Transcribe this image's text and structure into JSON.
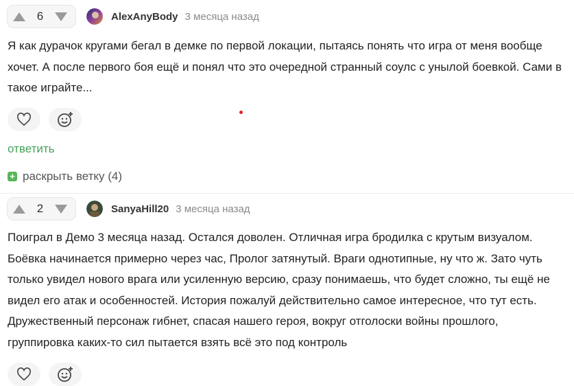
{
  "comments": [
    {
      "votes": "6",
      "username": "AlexAnyBody",
      "date": "3 месяца назад",
      "text": "Я как дурачок кругами бегал в демке по первой локации, пытаясь понять что игра от меня вообще хочет. А после первого боя ещё и понял что это очередной странный соулс с унылой боевкой. Сами в такое играйте...",
      "reply_label": "ответить",
      "expand_label": "раскрыть ветку (4)"
    },
    {
      "votes": "2",
      "username": "SanyaHill20",
      "date": "3 месяца назад",
      "text": "Поиграл в Демо 3 месяца назад. Остался доволен. Отличная игра бродилка с крутым визуалом. Боёвка начинается примерно через час, Пролог затянутый. Враги однотипные, ну что ж. Зато чуть только увидел нового врага или усиленную версию, сразу понимаешь, что будет сложно, ты ещё не видел его атак и особенностей. История пожалуй действительно самое интересное, что тут есть. Дружественный персонаж гибнет, спасая нашего героя, вокруг отголоски войны прошлого, группировка каких-то сил пытается взять всё это под контроль"
    }
  ],
  "colors": {
    "accent_green": "#44a35c",
    "vote_bg": "#f6f6f6",
    "action_bg": "#f4f4f4"
  }
}
